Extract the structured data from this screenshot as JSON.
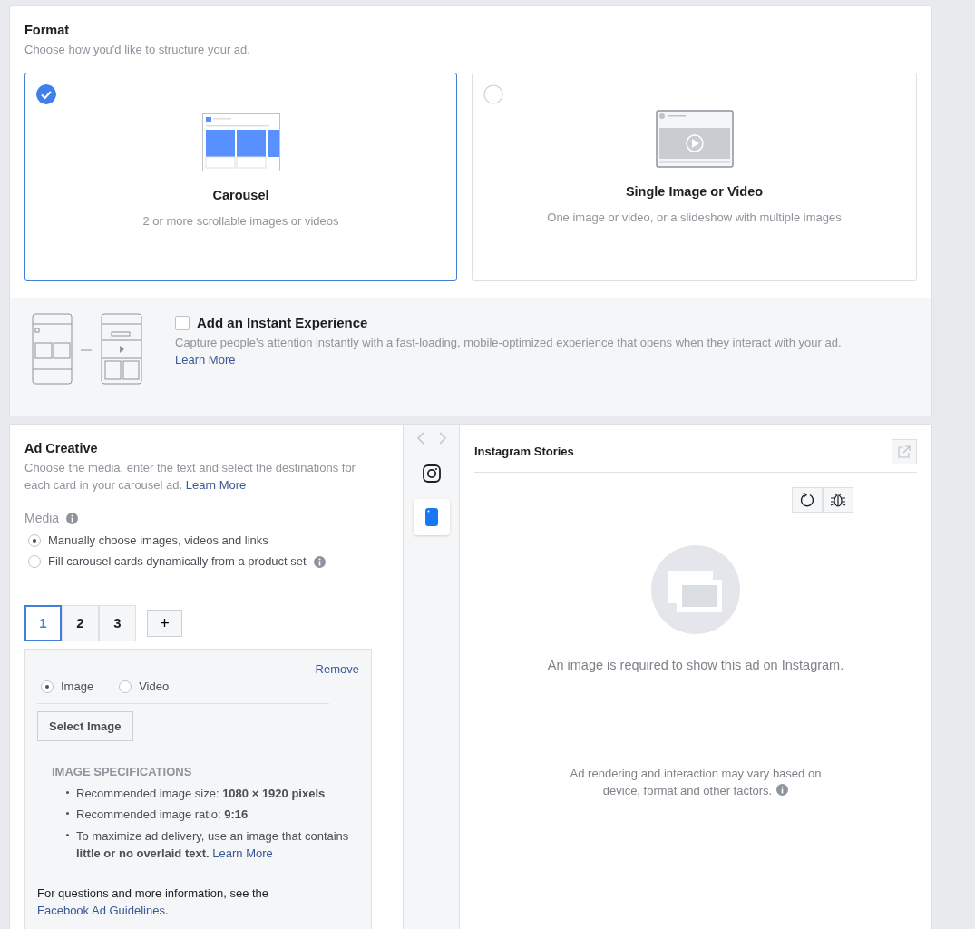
{
  "format": {
    "title": "Format",
    "subtitle": "Choose how you'd like to structure your ad.",
    "options": [
      {
        "kind": "carousel",
        "title": "Carousel",
        "description": "2 or more scrollable images or videos",
        "selected": true
      },
      {
        "kind": "single",
        "title": "Single Image or Video",
        "description": "One image or video, or a slideshow with multiple images",
        "selected": false
      }
    ]
  },
  "instant_experience": {
    "checked": false,
    "title": "Add an Instant Experience",
    "description": "Capture people's attention instantly with a fast-loading, mobile-optimized experience that opens when they interact with your ad.",
    "link": "Learn More"
  },
  "ad_creative": {
    "title": "Ad Creative",
    "description": "Choose the media, enter the text and select the destinations for each card in your carousel ad.",
    "link": "Learn More",
    "media_label": "Media",
    "media_options": [
      {
        "label": "Manually choose images, videos and links",
        "selected": true,
        "info": false
      },
      {
        "label": "Fill carousel cards dynamically from a product set",
        "selected": false,
        "info": true
      }
    ],
    "cards": [
      {
        "label": "1",
        "selected": true
      },
      {
        "label": "2",
        "selected": false
      },
      {
        "label": "3",
        "selected": false
      }
    ],
    "add_card": "+",
    "card_editor": {
      "remove": "Remove",
      "media_types": [
        {
          "label": "Image",
          "selected": true
        },
        {
          "label": "Video",
          "selected": false
        }
      ],
      "select_button": "Select Image",
      "specs_title": "IMAGE SPECIFICATIONS",
      "specs": [
        {
          "text": "Recommended image size: **1080 × 1920 pixels**"
        },
        {
          "text": "Recommended image ratio: **9:16**"
        },
        {
          "text": "To maximize ad delivery, use an image that contains **little or no overlaid text.**",
          "link": "Learn More"
        }
      ],
      "footer": {
        "text": "For questions and more information, see the",
        "link": "Facebook Ad Guidelines",
        "end": "."
      }
    }
  },
  "preview": {
    "platforms": [
      {
        "kind": "instagram",
        "selected": false
      },
      {
        "kind": "stories",
        "selected": true
      }
    ],
    "title": "Instagram Stories",
    "message": "An image is required to show this ad on Instagram.",
    "note": "Ad rendering and interaction may vary based on device, format and other factors."
  }
}
